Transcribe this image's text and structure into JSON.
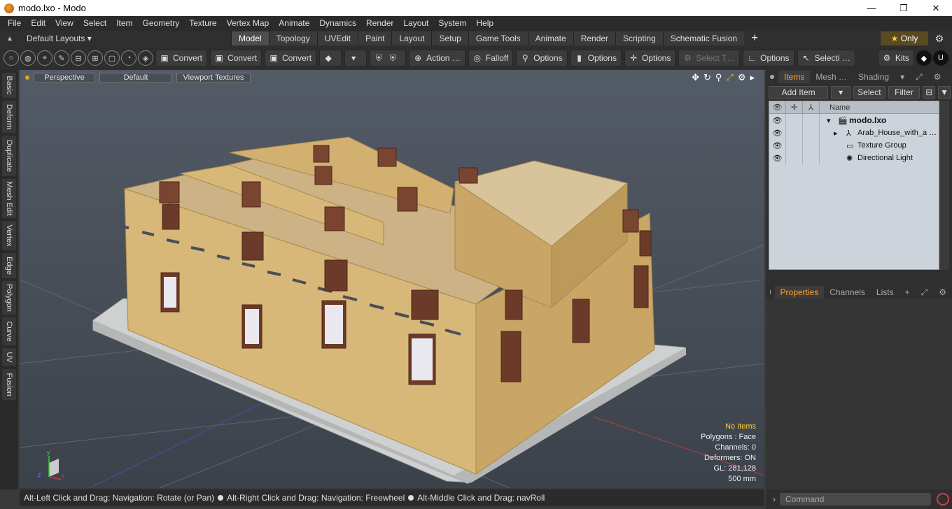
{
  "window": {
    "title": "modo.lxo - Modo",
    "min": "—",
    "max": "❐",
    "close": "✕"
  },
  "menu": [
    "File",
    "Edit",
    "View",
    "Select",
    "Item",
    "Geometry",
    "Texture",
    "Vertex Map",
    "Animate",
    "Dynamics",
    "Render",
    "Layout",
    "System",
    "Help"
  ],
  "layouts": {
    "label": "Default Layouts ▾"
  },
  "tabs": [
    "Model",
    "Topology",
    "UVEdit",
    "Paint",
    "Layout",
    "Setup",
    "Game Tools",
    "Animate",
    "Render",
    "Scripting",
    "Schematic Fusion"
  ],
  "active_tab": "Model",
  "only": {
    "label": "Only"
  },
  "toolbar": {
    "convert1": "Convert",
    "convert2": "Convert",
    "convert3": "Convert",
    "action": "Action …",
    "falloff": "Falloff",
    "options1": "Options",
    "options2": "Options",
    "options3": "Options",
    "select_t": "Select T…",
    "options4": "Options",
    "selecti": "Selecti …",
    "kits": "Kits"
  },
  "left_tabs": [
    "Basic",
    "Deform",
    "Duplicate",
    "Mesh Edit",
    "Vertex",
    "Edge",
    "Polygon",
    "Curve",
    "UV",
    "Fusion"
  ],
  "viewport": {
    "view": "Perspective",
    "shading": "Default",
    "textures": "Viewport Textures",
    "info": {
      "no_items": "No Items",
      "polygons": "Polygons : Face",
      "channels": "Channels: 0",
      "deformers": "Deformers: ON",
      "gl": "GL: 281,128",
      "scale": "500 mm"
    }
  },
  "status": {
    "hint1": "Alt-Left Click and Drag: Navigation: Rotate (or Pan)",
    "hint2": "Alt-Right Click and Drag: Navigation: Freewheel",
    "hint3": "Alt-Middle Click and Drag: navRoll"
  },
  "items_panel": {
    "tabs": [
      "Items",
      "Mesh …",
      "Shading"
    ],
    "add_item": "Add Item",
    "select": "Select",
    "filter": "Filter",
    "name_header": "Name",
    "rows": [
      {
        "label": "modo.lxo",
        "bold": true
      },
      {
        "label": "Arab_House_with_a …",
        "bold": false
      },
      {
        "label": "Texture Group",
        "bold": false
      },
      {
        "label": "Directional Light",
        "bold": false
      }
    ]
  },
  "properties_panel": {
    "tabs": [
      "Properties",
      "Channels",
      "Lists"
    ]
  },
  "command": {
    "placeholder": "Command"
  }
}
